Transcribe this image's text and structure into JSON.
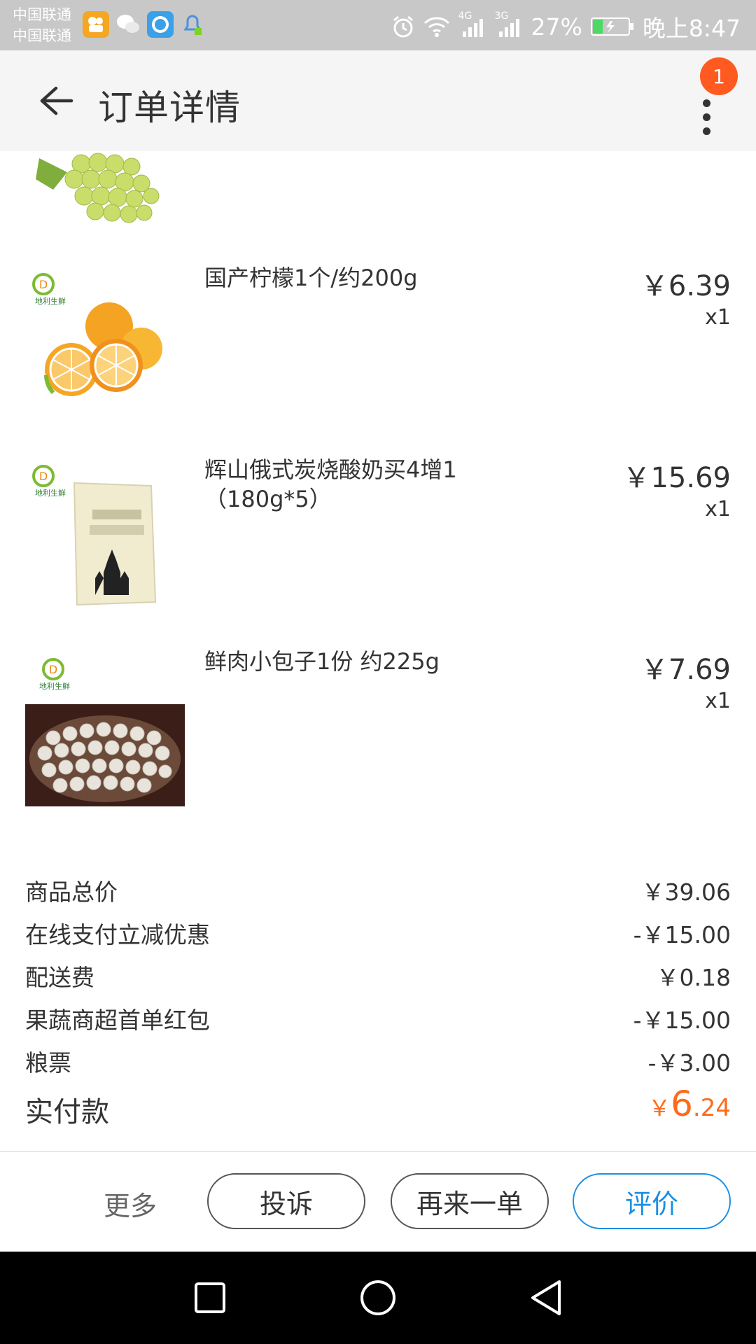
{
  "status_bar": {
    "carrier_1": "中国联通",
    "carrier_2": "中国联通",
    "battery_percent": "27%",
    "time": "晚上8:47",
    "network_1": "4G",
    "network_2": "3G",
    "battery_level": 0.27,
    "icons": [
      "kuaishou-app-icon",
      "wechat-icon",
      "qq-browser-icon",
      "notification-icon",
      "alarm-icon",
      "wifi-icon",
      "signal-4g-icon",
      "signal-3g-icon",
      "battery-icon"
    ]
  },
  "header": {
    "title": "订单详情",
    "badge_count": "1",
    "back_icon": "arrow-left-icon",
    "more_icon": "more-vertical-icon"
  },
  "products": [
    {
      "name": "",
      "image": "grapes-image"
    },
    {
      "name": "国产柠檬1个/约200g",
      "price": "￥6.39",
      "qty": "x1",
      "image": "lemons-image",
      "logo_text": "地利生鲜"
    },
    {
      "name": "辉山俄式炭烧酸奶买4增1（180g*5）",
      "price": "￥15.69",
      "qty": "x1",
      "image": "yogurt-bag-image",
      "logo_text": "地利生鲜"
    },
    {
      "name": "鲜肉小包子1份 约225g",
      "price": "￥7.69",
      "qty": "x1",
      "image": "steamed-buns-image",
      "logo_text": "地利生鲜"
    }
  ],
  "summary": [
    {
      "label": "商品总价",
      "value": "￥39.06"
    },
    {
      "label": "在线支付立减优惠",
      "value": "-￥15.00"
    },
    {
      "label": "配送费",
      "value": "￥0.18"
    },
    {
      "label": "果蔬商超首单红包",
      "value": "-￥15.00"
    },
    {
      "label": "粮票",
      "value": "-￥3.00"
    }
  ],
  "total": {
    "label": "实付款",
    "symbol": "￥",
    "integer": "6",
    "decimal": ".24"
  },
  "actions": {
    "more": "更多",
    "complain": "投诉",
    "reorder": "再来一单",
    "review": "评价"
  },
  "colors": {
    "accent_orange": "#ff6a1a",
    "badge": "#ff5a1f",
    "primary_blue": "#1a8fe3",
    "statusbar": "#c8c8c8",
    "appbar": "#f5f5f5"
  },
  "nav": {
    "icons": [
      "recent-apps-icon",
      "home-icon",
      "back-triangle-icon"
    ]
  }
}
